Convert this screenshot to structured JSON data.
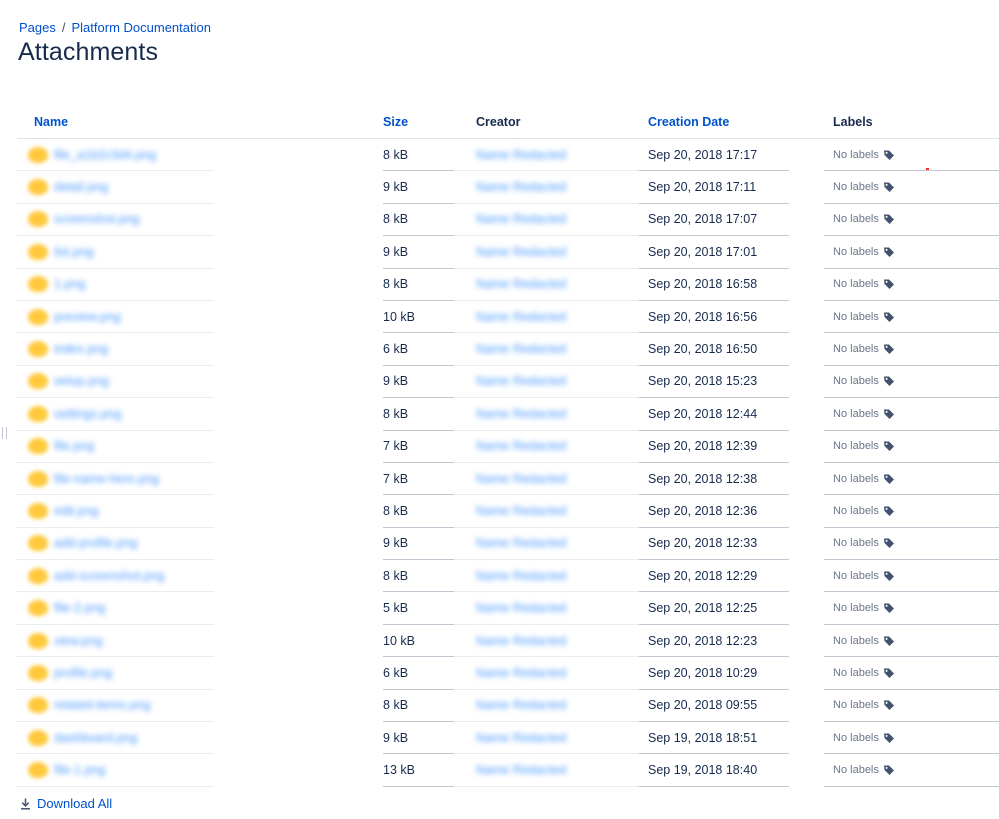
{
  "breadcrumb": {
    "items": [
      "Pages",
      "Platform Documentation"
    ],
    "separator": "/"
  },
  "page": {
    "title": "Attachments"
  },
  "table": {
    "columns": {
      "name": "Name",
      "size": "Size",
      "creator": "Creator",
      "creation_date": "Creation Date",
      "labels": "Labels"
    },
    "rows": [
      {
        "name": "file_a1b2c3d4.png",
        "size": "8 kB",
        "creator": "Name Redacted",
        "date": "Sep 20, 2018 17:17",
        "labels": "No labels"
      },
      {
        "name": "detail.png",
        "size": "9 kB",
        "creator": "Name Redacted",
        "date": "Sep 20, 2018 17:11",
        "labels": "No labels"
      },
      {
        "name": "screenshot.png",
        "size": "8 kB",
        "creator": "Name Redacted",
        "date": "Sep 20, 2018 17:07",
        "labels": "No labels"
      },
      {
        "name": "list.png",
        "size": "9 kB",
        "creator": "Name Redacted",
        "date": "Sep 20, 2018 17:01",
        "labels": "No labels"
      },
      {
        "name": "1.png",
        "size": "8 kB",
        "creator": "Name Redacted",
        "date": "Sep 20, 2018 16:58",
        "labels": "No labels"
      },
      {
        "name": "preview.png",
        "size": "10 kB",
        "creator": "Name Redacted",
        "date": "Sep 20, 2018 16:56",
        "labels": "No labels"
      },
      {
        "name": "index.png",
        "size": "6 kB",
        "creator": "Name Redacted",
        "date": "Sep 20, 2018 16:50",
        "labels": "No labels"
      },
      {
        "name": "setup.png",
        "size": "9 kB",
        "creator": "Name Redacted",
        "date": "Sep 20, 2018 15:23",
        "labels": "No labels"
      },
      {
        "name": "settings.png",
        "size": "8 kB",
        "creator": "Name Redacted",
        "date": "Sep 20, 2018 12:44",
        "labels": "No labels"
      },
      {
        "name": "file.png",
        "size": "7 kB",
        "creator": "Name Redacted",
        "date": "Sep 20, 2018 12:39",
        "labels": "No labels"
      },
      {
        "name": "file-name-here.png",
        "size": "7 kB",
        "creator": "Name Redacted",
        "date": "Sep 20, 2018 12:38",
        "labels": "No labels"
      },
      {
        "name": "edit.png",
        "size": "8 kB",
        "creator": "Name Redacted",
        "date": "Sep 20, 2018 12:36",
        "labels": "No labels"
      },
      {
        "name": "add-profile.png",
        "size": "9 kB",
        "creator": "Name Redacted",
        "date": "Sep 20, 2018 12:33",
        "labels": "No labels"
      },
      {
        "name": "add-screenshot.png",
        "size": "8 kB",
        "creator": "Name Redacted",
        "date": "Sep 20, 2018 12:29",
        "labels": "No labels"
      },
      {
        "name": "file-2.png",
        "size": "5 kB",
        "creator": "Name Redacted",
        "date": "Sep 20, 2018 12:25",
        "labels": "No labels"
      },
      {
        "name": "view.png",
        "size": "10 kB",
        "creator": "Name Redacted",
        "date": "Sep 20, 2018 12:23",
        "labels": "No labels"
      },
      {
        "name": "profile.png",
        "size": "6 kB",
        "creator": "Name Redacted",
        "date": "Sep 20, 2018 10:29",
        "labels": "No labels"
      },
      {
        "name": "related-items.png",
        "size": "8 kB",
        "creator": "Name Redacted",
        "date": "Sep 20, 2018 09:55",
        "labels": "No labels"
      },
      {
        "name": "dashboard.png",
        "size": "9 kB",
        "creator": "Name Redacted",
        "date": "Sep 19, 2018 18:51",
        "labels": "No labels"
      },
      {
        "name": "file-1.png",
        "size": "13 kB",
        "creator": "Name Redacted",
        "date": "Sep 19, 2018 18:40",
        "labels": "No labels"
      }
    ]
  },
  "footer": {
    "download_all": "Download All"
  },
  "icons": {
    "file": "image-file-icon",
    "label": "tag-icon",
    "download": "download-icon"
  },
  "colors": {
    "link": "#0052cc",
    "text": "#172b4d",
    "muted": "#6b778c",
    "file_icon": "#ffc93b"
  }
}
